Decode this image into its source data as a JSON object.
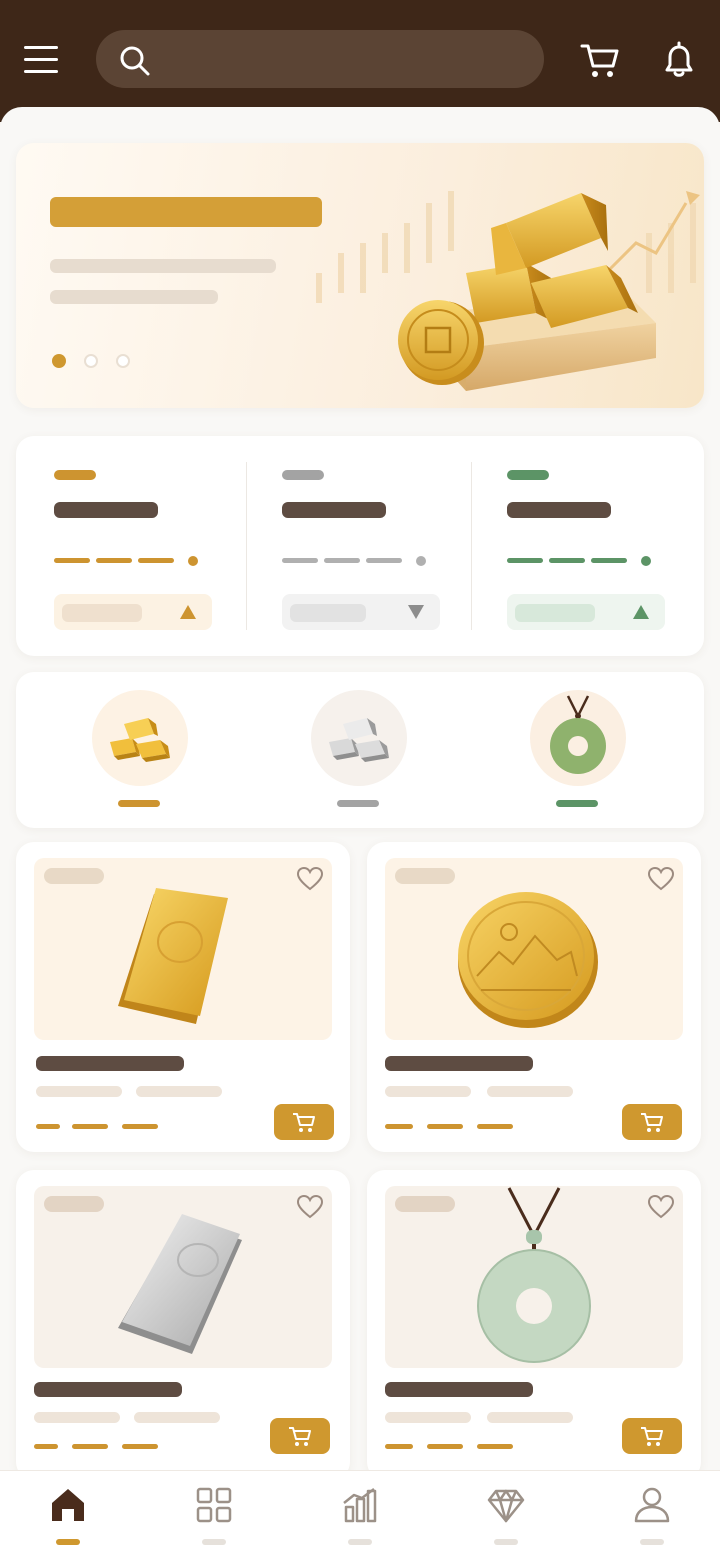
{
  "header": {
    "search_placeholder": "",
    "icons": [
      "menu-icon",
      "search-icon",
      "cart-icon",
      "bell-icon"
    ]
  },
  "banner": {
    "slides": 3,
    "active_slide": 1
  },
  "metals": [
    {
      "id": "gold",
      "color": "#cd9430",
      "trend": "up"
    },
    {
      "id": "silver",
      "color": "#a3a3a3",
      "trend": "down"
    },
    {
      "id": "jade",
      "color": "#5c9466",
      "trend": "up"
    }
  ],
  "categories": [
    {
      "id": "gold-bars",
      "icon": "gold-bars-icon",
      "color": "#cd9430"
    },
    {
      "id": "silver-bars",
      "icon": "silver-bars-icon",
      "color": "#a3a3a3"
    },
    {
      "id": "jade-pendant",
      "icon": "jade-pendant-icon",
      "color": "#5c9466"
    }
  ],
  "products": [
    {
      "id": "gold-bar",
      "image": "gold-bar-image"
    },
    {
      "id": "gold-coin",
      "image": "gold-coin-image"
    },
    {
      "id": "silver-bar",
      "image": "silver-bar-image"
    },
    {
      "id": "jade-pendant",
      "image": "jade-pendant-image"
    }
  ],
  "bottom_nav": [
    {
      "id": "home",
      "icon": "home-icon",
      "active": true
    },
    {
      "id": "categories",
      "icon": "grid-icon",
      "active": false
    },
    {
      "id": "market",
      "icon": "chart-icon",
      "active": false
    },
    {
      "id": "jewelry",
      "icon": "diamond-icon",
      "active": false
    },
    {
      "id": "profile",
      "icon": "user-icon",
      "active": false
    }
  ],
  "colors": {
    "header": "#3e2718",
    "accent_gold": "#cf982f",
    "silver": "#a3a3a3",
    "jade": "#5c9466",
    "title_skeleton": "#5e4c42"
  }
}
